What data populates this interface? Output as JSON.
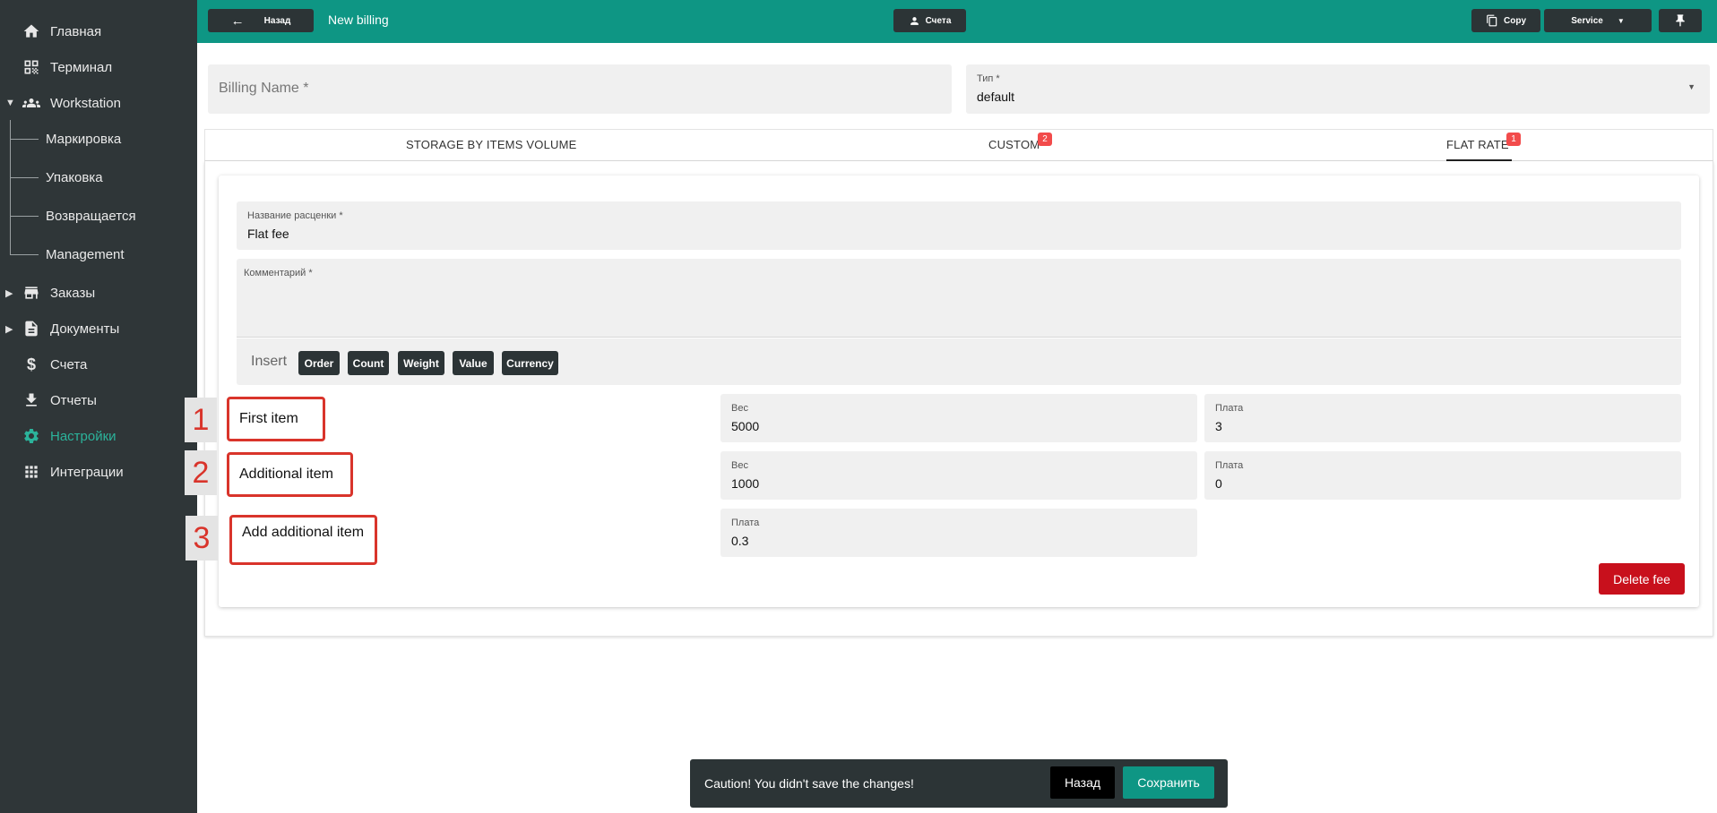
{
  "sidebar": {
    "items": [
      {
        "label": "Главная"
      },
      {
        "label": "Терминал"
      },
      {
        "label": "Workstation"
      },
      {
        "label": "Заказы"
      },
      {
        "label": "Документы"
      },
      {
        "label": "Счета"
      },
      {
        "label": "Отчеты"
      },
      {
        "label": "Настройки"
      },
      {
        "label": "Интеграции"
      }
    ],
    "sub_items": [
      {
        "label": "Маркировка"
      },
      {
        "label": "Упаковка"
      },
      {
        "label": "Возвращается"
      },
      {
        "label": "Management"
      }
    ]
  },
  "topbar": {
    "back_label": "Назад",
    "title": "New billing",
    "accounts_label": "Счета",
    "copy_label": "Copy",
    "service_label": "Service"
  },
  "form": {
    "billing_name_placeholder": "Billing Name *",
    "type_label": "Тип *",
    "type_value": "default"
  },
  "tabs": [
    {
      "label": "STORAGE BY ITEMS VOLUME",
      "badge": ""
    },
    {
      "label": "CUSTOM",
      "badge": "2"
    },
    {
      "label": "FLAT RATE",
      "badge": "1"
    }
  ],
  "fee": {
    "name_label": "Название расценки *",
    "name_value": "Flat fee",
    "comment_label": "Комментарий *",
    "insert_label": "Insert",
    "insert_buttons": [
      "Order",
      "Count",
      "Weight",
      "Value",
      "Currency"
    ],
    "rows": [
      {
        "number": "1",
        "title": "First item",
        "weight_label": "Вес",
        "weight_value": "5000",
        "pay_label": "Плата",
        "pay_value": "3"
      },
      {
        "number": "2",
        "title": "Additional item",
        "weight_label": "Вес",
        "weight_value": "1000",
        "pay_label": "Плата",
        "pay_value": "0"
      },
      {
        "number": "3",
        "title": "Add additional item",
        "pay_label": "Плата",
        "pay_value": "0.3"
      }
    ],
    "delete_label": "Delete fee"
  },
  "snackbar": {
    "message": "Caution! You didn't save the changes!",
    "back_label": "Назад",
    "save_label": "Сохранить"
  },
  "colors": {
    "topbar": "#0e9684",
    "sidebar": "#2f3638",
    "active": "#2bb39b",
    "danger": "#c8101c",
    "badge": "#f24b4b",
    "annotation": "#d9342b"
  }
}
